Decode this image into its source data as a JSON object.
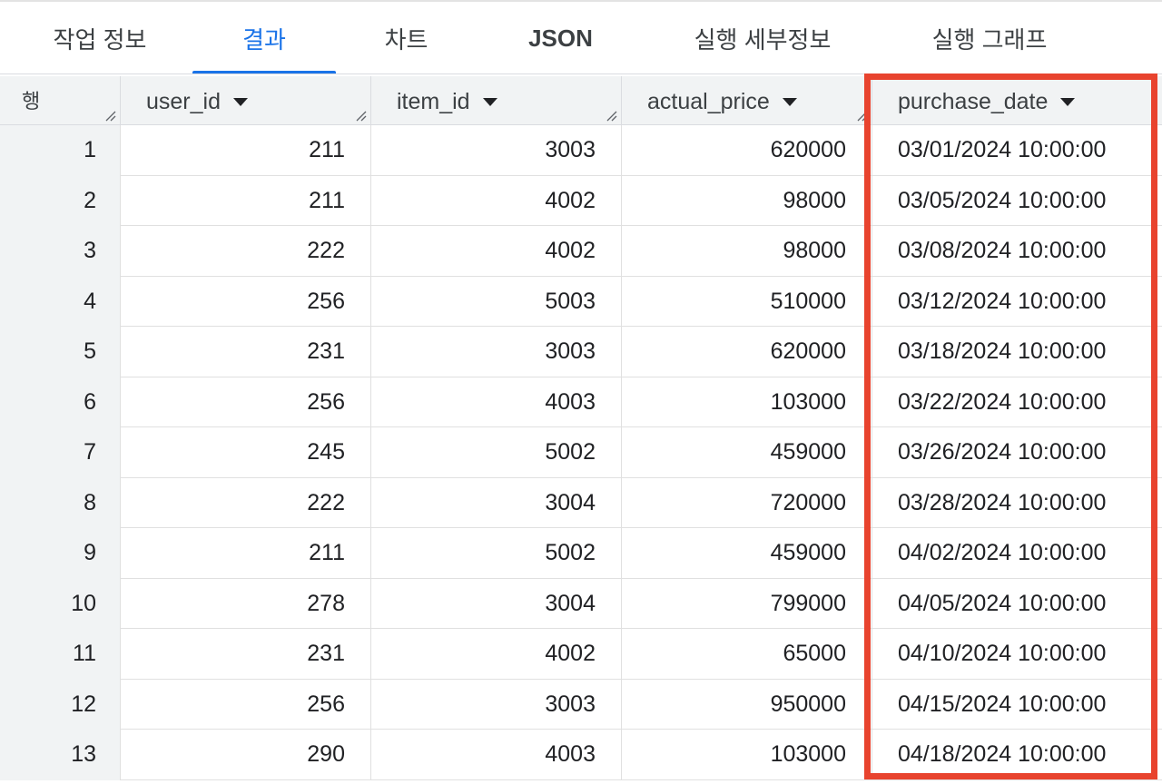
{
  "tabs": [
    {
      "label": "작업 정보",
      "active": false
    },
    {
      "label": "결과",
      "active": true
    },
    {
      "label": "차트",
      "active": false
    },
    {
      "label": "JSON",
      "active": false
    },
    {
      "label": "실행 세부정보",
      "active": false
    },
    {
      "label": "실행 그래프",
      "active": false
    }
  ],
  "table": {
    "row_header": "행",
    "columns": [
      "user_id",
      "item_id",
      "actual_price",
      "purchase_date"
    ],
    "rows": [
      [
        "1",
        "211",
        "3003",
        "620000",
        "03/01/2024 10:00:00"
      ],
      [
        "2",
        "211",
        "4002",
        "98000",
        "03/05/2024 10:00:00"
      ],
      [
        "3",
        "222",
        "4002",
        "98000",
        "03/08/2024 10:00:00"
      ],
      [
        "4",
        "256",
        "5003",
        "510000",
        "03/12/2024 10:00:00"
      ],
      [
        "5",
        "231",
        "3003",
        "620000",
        "03/18/2024 10:00:00"
      ],
      [
        "6",
        "256",
        "4003",
        "103000",
        "03/22/2024 10:00:00"
      ],
      [
        "7",
        "245",
        "5002",
        "459000",
        "03/26/2024 10:00:00"
      ],
      [
        "8",
        "222",
        "3004",
        "720000",
        "03/28/2024 10:00:00"
      ],
      [
        "9",
        "211",
        "5002",
        "459000",
        "04/02/2024 10:00:00"
      ],
      [
        "10",
        "278",
        "3004",
        "799000",
        "04/05/2024 10:00:00"
      ],
      [
        "11",
        "231",
        "4002",
        "65000",
        "04/10/2024 10:00:00"
      ],
      [
        "12",
        "256",
        "3003",
        "950000",
        "04/15/2024 10:00:00"
      ],
      [
        "13",
        "290",
        "4003",
        "103000",
        "04/18/2024 10:00:00"
      ]
    ]
  },
  "highlight": {
    "column": "purchase_date",
    "color": "#e8432e"
  },
  "colors": {
    "accent": "#1a73e8",
    "header_bg": "#f1f3f4"
  }
}
